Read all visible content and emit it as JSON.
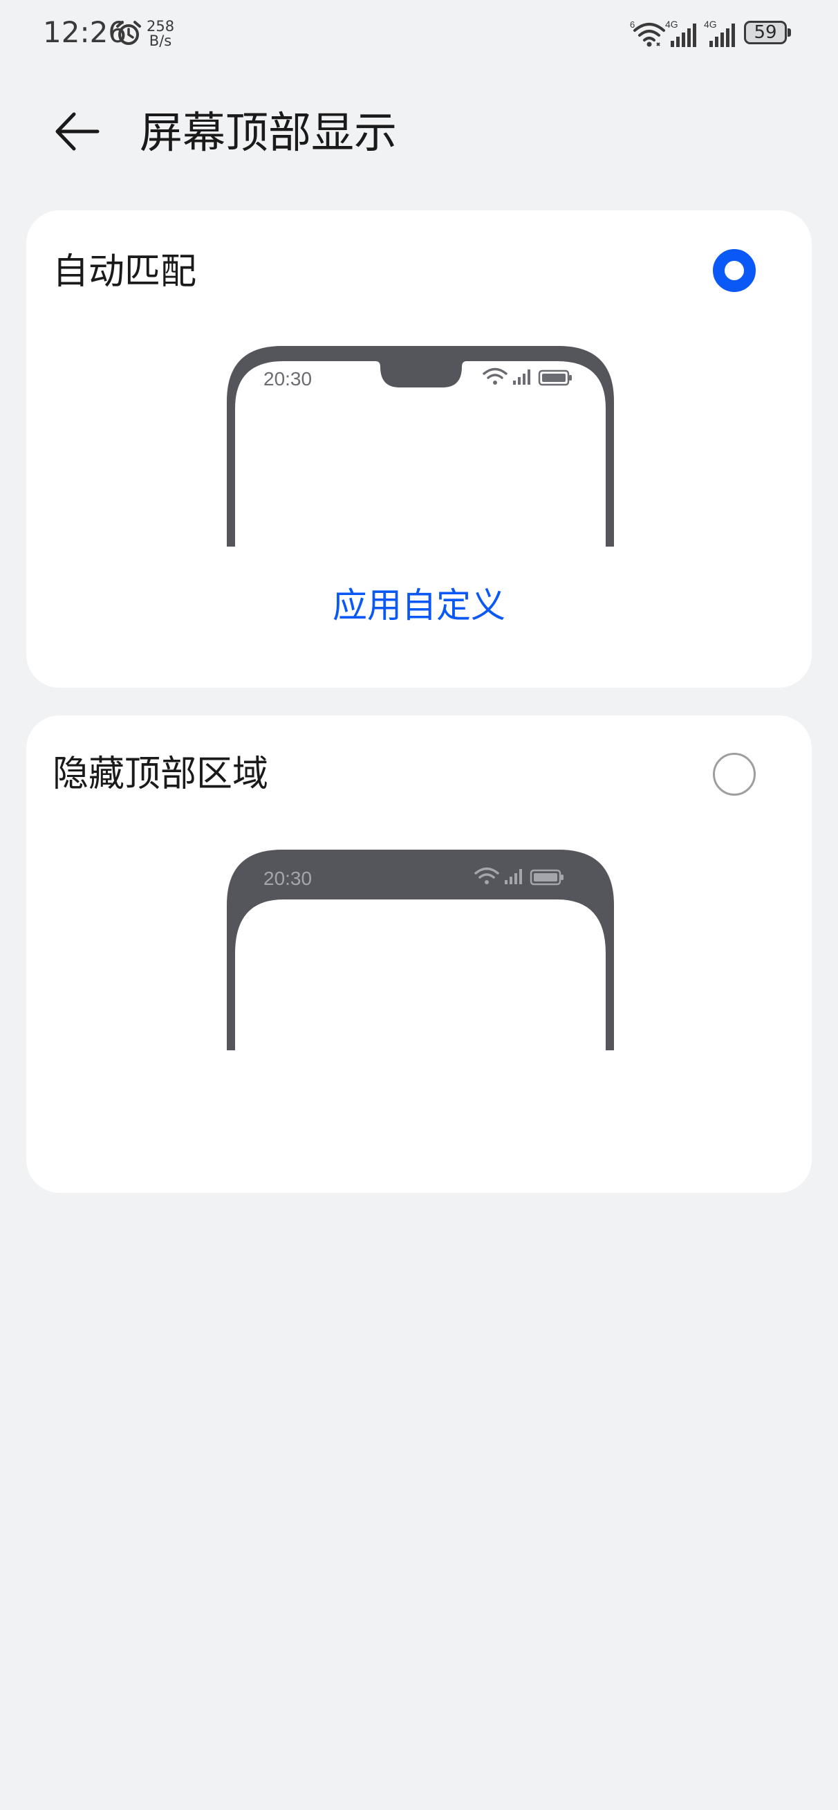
{
  "status_bar": {
    "time": "12:26",
    "net_speed_value": "258",
    "net_speed_unit": "B/s",
    "wifi_badge": "6",
    "signal1_label": "4G",
    "signal2_label": "4G",
    "battery_level": "59",
    "icons": [
      "alarm-icon",
      "wifi-icon",
      "cellular-signal-icon",
      "cellular-signal-icon",
      "battery-icon"
    ]
  },
  "header": {
    "title": "屏幕顶部显示",
    "back_icon": "arrow-left-icon"
  },
  "options": [
    {
      "label": "自动匹配",
      "selected": true,
      "preview_time": "20:30",
      "link_label": "应用自定义"
    },
    {
      "label": "隐藏顶部区域",
      "selected": false,
      "preview_time": "20:30"
    }
  ],
  "colors": {
    "accent": "#0a59f7",
    "background": "#f1f2f4",
    "card": "#ffffff",
    "phone_frame": "#55565c",
    "radio_unselected": "#9e9e9e"
  }
}
